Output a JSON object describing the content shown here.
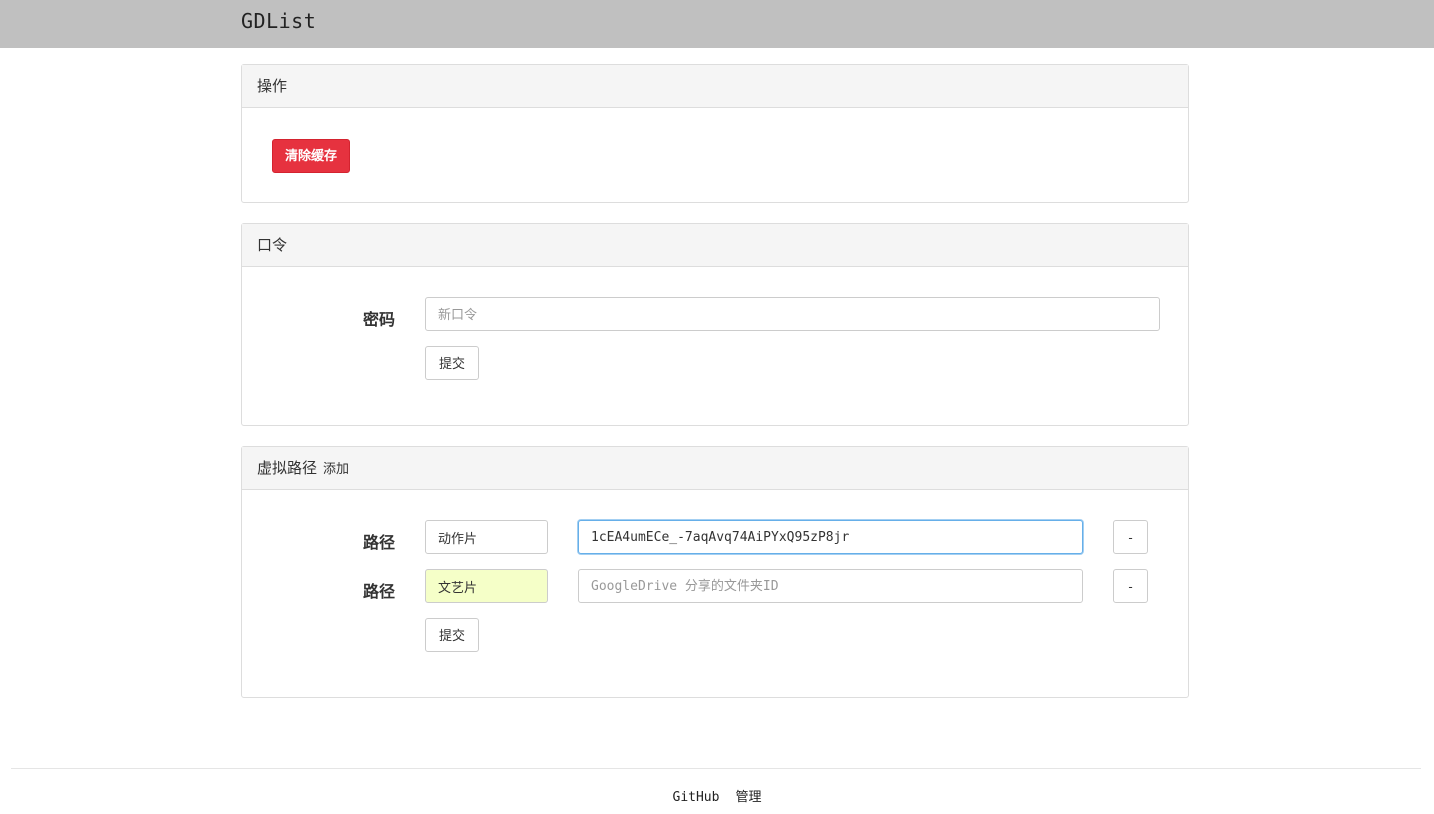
{
  "header": {
    "title": "GDList"
  },
  "actions_panel": {
    "heading": "操作",
    "clear_cache_label": "清除缓存"
  },
  "password_panel": {
    "heading": "口令",
    "field_label": "密码",
    "input_value": "",
    "input_placeholder": "新口令",
    "submit_label": "提交"
  },
  "paths_panel": {
    "heading": "虚拟路径",
    "add_label": "添加",
    "rows": [
      {
        "label": "路径",
        "name_value": "动作片",
        "id_value": "1cEA4umECe_-7aqAvq74AiPYxQ95zP8jr",
        "id_placeholder": "GoogleDrive 分享的文件夹ID",
        "remove_label": "-"
      },
      {
        "label": "路径",
        "name_value": "文艺片",
        "id_value": "",
        "id_placeholder": "GoogleDrive 分享的文件夹ID",
        "remove_label": "-"
      }
    ],
    "submit_label": "提交"
  },
  "footer": {
    "links": [
      "GitHub",
      "管理"
    ]
  },
  "colors": {
    "topbar": "#c0c0c0",
    "danger": "#e6323f",
    "focus_border": "#66afe9",
    "highlight_input": "#f5ffc8"
  }
}
